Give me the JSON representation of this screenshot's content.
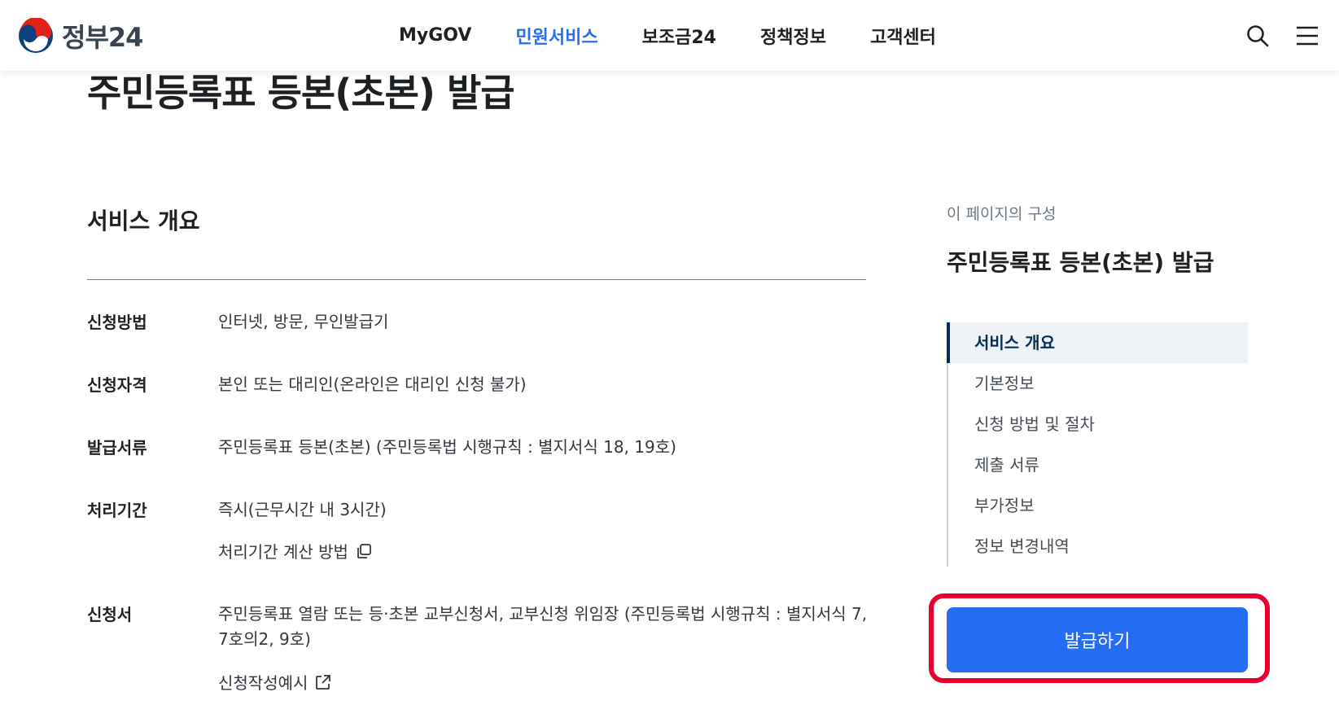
{
  "header": {
    "logo_text": "정부24",
    "nav": [
      {
        "label": "MyGOV",
        "active": false
      },
      {
        "label": "민원서비스",
        "active": true
      },
      {
        "label": "보조금24",
        "active": false
      },
      {
        "label": "정책정보",
        "active": false
      },
      {
        "label": "고객센터",
        "active": false
      }
    ],
    "search_icon": "search-icon",
    "menu_icon": "hamburger-menu-icon"
  },
  "page": {
    "title": "주민등록표 등본(초본) 발급"
  },
  "overview": {
    "section_title": "서비스 개요",
    "rows": [
      {
        "label": "신청방법",
        "value": "인터넷, 방문, 무인발급기"
      },
      {
        "label": "신청자격",
        "value": "본인 또는 대리인(온라인은 대리인 신청 불가)"
      },
      {
        "label": "발급서류",
        "value": "주민등록표 등본(초본) (주민등록법 시행규칙 : 별지서식 18, 19호)"
      },
      {
        "label": "처리기간",
        "value": "즉시(근무시간 내 3시간)",
        "link": "처리기간 계산 방법",
        "link_icon": "copy-window-icon"
      },
      {
        "label": "신청서",
        "value": "주민등록표 열람 또는 등·초본 교부신청서, 교부신청 위임장 (주민등록법 시행규칙 : 별지서식 7, 7호의2, 9호)",
        "link": "신청작성예시",
        "link_icon": "external-link-icon"
      }
    ]
  },
  "toc": {
    "caption": "이 페이지의 구성",
    "title": "주민등록표 등본(초본) 발급",
    "items": [
      {
        "label": "서비스 개요",
        "active": true
      },
      {
        "label": "기본정보",
        "active": false
      },
      {
        "label": "신청 방법 및 절차",
        "active": false
      },
      {
        "label": "제출 서류",
        "active": false
      },
      {
        "label": "부가정보",
        "active": false
      },
      {
        "label": "정보 변경내역",
        "active": false
      }
    ]
  },
  "cta": {
    "label": "발급하기"
  },
  "colors": {
    "accent": "#256ef4",
    "highlight": "#e6002d",
    "toc_active": "#052b57"
  }
}
